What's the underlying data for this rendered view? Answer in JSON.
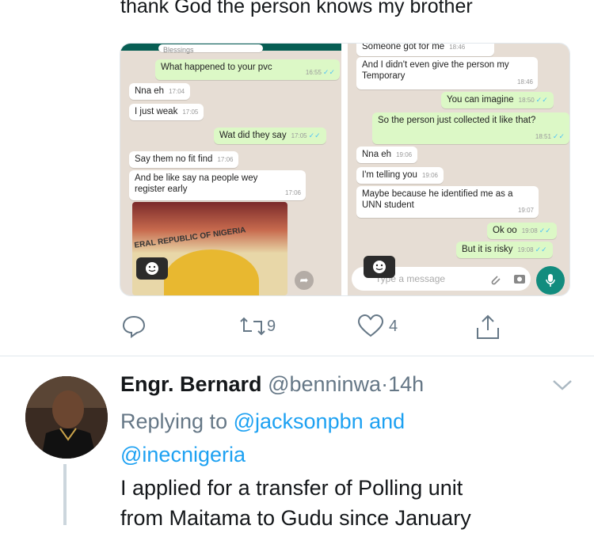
{
  "tweet1": {
    "text": "thank God the person knows my brother",
    "actions": {
      "reply_count": "",
      "retweet_count": "9",
      "like_count": "4"
    }
  },
  "chat_left": {
    "top_label": "Blessings",
    "messages": [
      {
        "text": "What happened to your pvc",
        "time": "16:55",
        "dir": "out"
      },
      {
        "text": "Nna eh",
        "time": "17:04",
        "dir": "in"
      },
      {
        "text": "I just weak",
        "time": "17:05",
        "dir": "in"
      },
      {
        "text": "Wat did they say",
        "time": "17:05",
        "dir": "out"
      },
      {
        "text": "Say them no fit find",
        "time": "17:06",
        "dir": "in"
      },
      {
        "text": "And be like say na people wey register early",
        "time": "17:06",
        "dir": "in"
      }
    ],
    "card_text": "ERAL REPUBLIC OF NIGERIA"
  },
  "chat_right": {
    "messages": [
      {
        "text": "Someone got for me",
        "time": "18:46",
        "dir": "in"
      },
      {
        "text": "And I didn't even give the person my Temporary",
        "time": "18:46",
        "dir": "in"
      },
      {
        "text": "You can imagine",
        "time": "18:50",
        "dir": "out"
      },
      {
        "text": "So the person just collected it like that?",
        "time": "18:51",
        "dir": "out"
      },
      {
        "text": "Nna eh",
        "time": "19:06",
        "dir": "in"
      },
      {
        "text": "I'm telling you",
        "time": "19:06",
        "dir": "in"
      },
      {
        "text": "Maybe because he identified me as a UNN student",
        "time": "19:07",
        "dir": "in"
      },
      {
        "text": "Ok oo",
        "time": "19:08",
        "dir": "out"
      },
      {
        "text": "But it is risky",
        "time": "19:08",
        "dir": "out"
      }
    ],
    "input_placeholder": "Type a message"
  },
  "tweet2": {
    "name": "Engr. Bernard",
    "handle": "@benninwa",
    "dot": "·",
    "time": "14h",
    "replying_prefix": "Replying to",
    "replying_to_1": "@jacksonpbn",
    "replying_and": "and",
    "replying_to_2": "@inecnigeria",
    "body_line1": "I applied for a transfer of Polling unit",
    "body_line2": "from Maitama to Gudu since January"
  },
  "colors": {
    "accent": "#1da1f2",
    "muted": "#657786",
    "wa_green": "#075e54",
    "wa_out": "#dcf8c6"
  }
}
